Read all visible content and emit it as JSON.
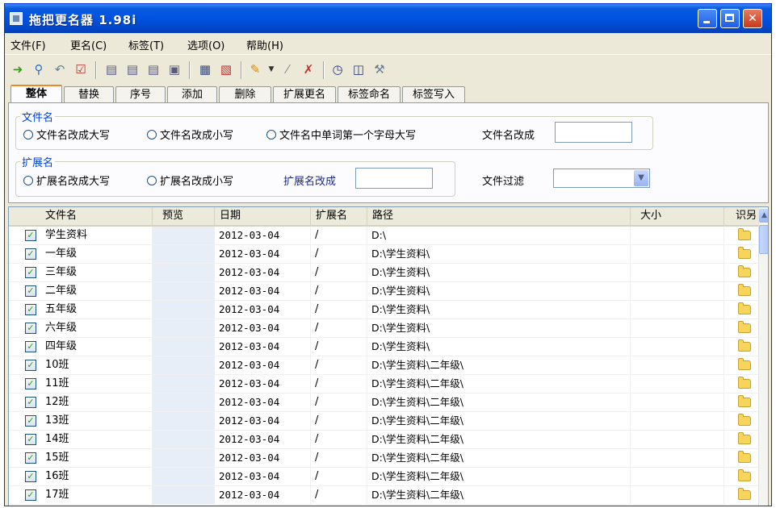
{
  "window": {
    "title": "拖把更名器  1.98i"
  },
  "menu": [
    {
      "label": "文件(F)"
    },
    {
      "label": "更名(C)"
    },
    {
      "label": "标签(T)"
    },
    {
      "label": "选项(O)"
    },
    {
      "label": "帮助(H)"
    }
  ],
  "toolbar": {
    "icons": [
      "add-files-icon",
      "search-icon",
      "undo-icon",
      "check-all-icon",
      "tag-icon",
      "tag-icon",
      "tag-icon",
      "tag-icon",
      "document-icon",
      "clear-icon",
      "brush-icon",
      "filter-icon",
      "delete-filter-icon",
      "clock-icon",
      "window-icon",
      "tools-icon"
    ]
  },
  "tabs": [
    {
      "label": "整体"
    },
    {
      "label": "替换"
    },
    {
      "label": "序号"
    },
    {
      "label": "添加"
    },
    {
      "label": "删除"
    },
    {
      "label": "扩展更名"
    },
    {
      "label": "标签命名"
    },
    {
      "label": "标签写入"
    }
  ],
  "options": {
    "filename_group": {
      "legend": "文件名",
      "upper": "文件名改成大写",
      "lower": "文件名改成小写",
      "capitalize": "文件名中单词第一个字母大写"
    },
    "filename_change_label": "文件名改成",
    "filename_change_value": "",
    "ext_group": {
      "legend": "扩展名",
      "upper": "扩展名改成大写",
      "lower": "扩展名改成小写"
    },
    "ext_change_label": "扩展名改成",
    "ext_change_value": "",
    "filter_label": "文件过滤",
    "filter_value": ""
  },
  "list": {
    "columns": {
      "name": "文件名",
      "preview": "预览",
      "date": "日期",
      "ext": "扩展名",
      "path": "路径",
      "size": "大小",
      "rec": "识另"
    },
    "rows": [
      {
        "name": "学生资料",
        "date": "2012-03-04",
        "ext": "/",
        "path": "D:\\"
      },
      {
        "name": "一年级",
        "date": "2012-03-04",
        "ext": "/",
        "path": "D:\\学生资料\\"
      },
      {
        "name": "三年级",
        "date": "2012-03-04",
        "ext": "/",
        "path": "D:\\学生资料\\"
      },
      {
        "name": "二年级",
        "date": "2012-03-04",
        "ext": "/",
        "path": "D:\\学生资料\\"
      },
      {
        "name": "五年级",
        "date": "2012-03-04",
        "ext": "/",
        "path": "D:\\学生资料\\"
      },
      {
        "name": "六年级",
        "date": "2012-03-04",
        "ext": "/",
        "path": "D:\\学生资料\\"
      },
      {
        "name": "四年级",
        "date": "2012-03-04",
        "ext": "/",
        "path": "D:\\学生资料\\"
      },
      {
        "name": "10班",
        "date": "2012-03-04",
        "ext": "/",
        "path": "D:\\学生资料\\二年级\\"
      },
      {
        "name": "11班",
        "date": "2012-03-04",
        "ext": "/",
        "path": "D:\\学生资料\\二年级\\"
      },
      {
        "name": "12班",
        "date": "2012-03-04",
        "ext": "/",
        "path": "D:\\学生资料\\二年级\\"
      },
      {
        "name": "13班",
        "date": "2012-03-04",
        "ext": "/",
        "path": "D:\\学生资料\\二年级\\"
      },
      {
        "name": "14班",
        "date": "2012-03-04",
        "ext": "/",
        "path": "D:\\学生资料\\二年级\\"
      },
      {
        "name": "15班",
        "date": "2012-03-04",
        "ext": "/",
        "path": "D:\\学生资料\\二年级\\"
      },
      {
        "name": "16班",
        "date": "2012-03-04",
        "ext": "/",
        "path": "D:\\学生资料\\二年级\\"
      },
      {
        "name": "17班",
        "date": "2012-03-04",
        "ext": "/",
        "path": "D:\\学生资料\\二年级\\"
      }
    ]
  },
  "colors": {
    "title_bar": "#0052e0",
    "active_tab_accent": "#e68b2c",
    "group_legend": "#0046d5"
  }
}
